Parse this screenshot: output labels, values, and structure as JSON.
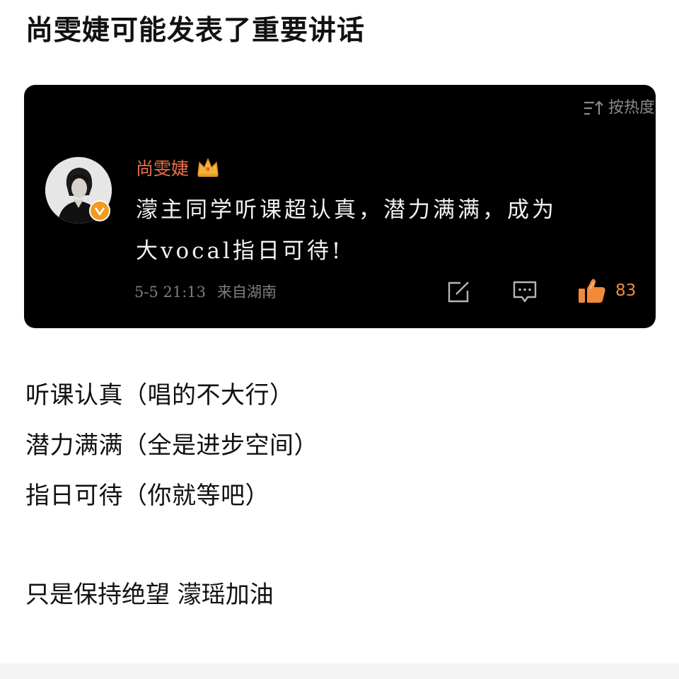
{
  "post": {
    "title": "尚雯婕可能发表了重要讲话"
  },
  "comment_card": {
    "sort_label": "按热度",
    "sort_icon": "sort-descending-icon",
    "username": "尚雯婕",
    "crown_icon": "crown-icon",
    "verified_badge": "verified-v-icon",
    "text_line_1": "濛主同学听课超认真，潜力满满，成为",
    "text_line_2": "大vocal指日可待!",
    "timestamp": "5-5 21:13",
    "location": "来自湖南",
    "share_icon": "share-edit-icon",
    "reply_icon": "comment-icon",
    "like_icon": "thumbs-up-icon",
    "like_count": "83",
    "colors": {
      "background": "#000000",
      "username": "#e8704a",
      "like": "#f08a3a",
      "verified": "#f39b1f"
    }
  },
  "annotations": [
    "听课认真（唱的不大行）",
    "潜力满满（全是进步空间）",
    "指日可待（你就等吧）"
  ],
  "closing": "只是保持绝望 濛瑶加油"
}
